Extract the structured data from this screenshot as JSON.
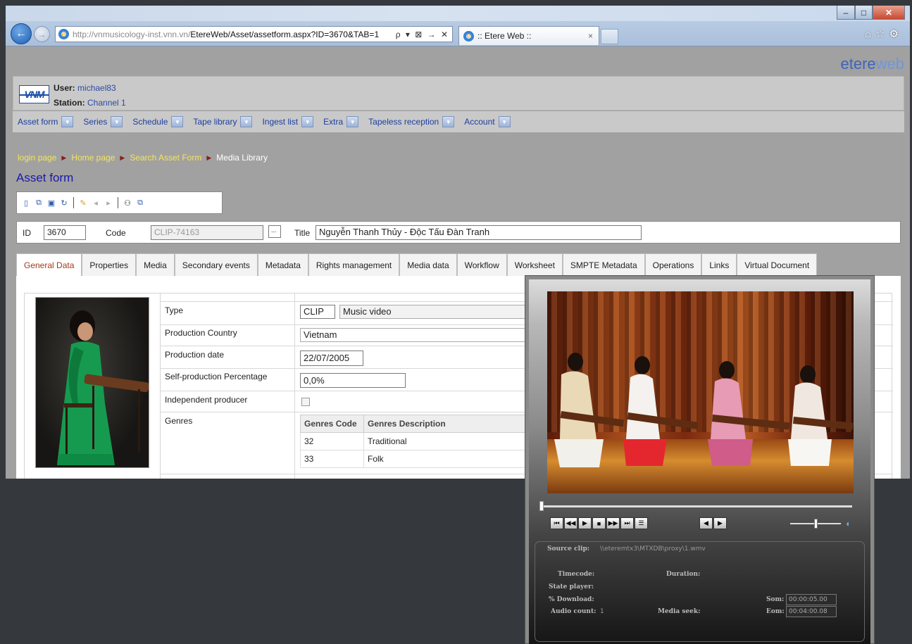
{
  "browser": {
    "url_host": "http://vnmusicology-inst.vnn.vn/",
    "url_path": "EtereWeb/Asset/assetform.aspx?ID=3670&TAB=1",
    "addr_controls": "ρ ▾ ⊠ → ✕",
    "tab_title": ":: Etere Web ::",
    "tab_close": "×",
    "window_min": "–",
    "window_max": "□",
    "window_close": "✕",
    "tools": "⌂☆⚙"
  },
  "brand": {
    "main": "etere",
    "accent": "web"
  },
  "user": {
    "logo": "VNM",
    "user_label": "User:",
    "user_value": "michael83",
    "station_label": "Station:",
    "station_value": "Channel 1"
  },
  "menu": [
    "Asset form",
    "Series",
    "Schedule",
    "Tape library",
    "Ingest list",
    "Extra",
    "Tapeless reception",
    "Account"
  ],
  "breadcrumb": [
    "login page",
    "Home page",
    "Search Asset Form",
    "Media Library"
  ],
  "form_title": "Asset form",
  "idbar": {
    "id_label": "ID",
    "id_value": "3670",
    "code_label": "Code",
    "code_value": "CLIP-74163",
    "browse": "...",
    "title_label": "Title",
    "title_value": "Nguyễn Thanh Thủy - Độc Tấu Đàn Tranh"
  },
  "tabs": [
    "General Data",
    "Properties",
    "Media",
    "Secondary events",
    "Metadata",
    "Rights management",
    "Media data",
    "Workflow",
    "Worksheet",
    "SMPTE Metadata",
    "Operations",
    "Links",
    "Virtual Document"
  ],
  "general": {
    "type_label": "Type",
    "type_code": "CLIP",
    "type_desc": "Music video",
    "country_label": "Production Country",
    "country_value": "Vietnam",
    "date_label": "Production date",
    "date_value": "22/07/2005",
    "selfprod_label": "Self-production Percentage",
    "selfprod_value": "0,0%",
    "indep_label": "Independent producer",
    "genres_label": "Genres",
    "genres_headers": [
      "Genres Code",
      "Genres Description"
    ],
    "genres_rows": [
      [
        "32",
        "Traditional"
      ],
      [
        "33",
        "Folk"
      ]
    ]
  },
  "player": {
    "source_label": "Source clip:",
    "source_value": "\\\\eteremtx3\\MTXDB\\proxy\\1.wmv",
    "timecode_label": "Timecode:",
    "duration_label": "Duration:",
    "state_label": "State player:",
    "download_label": "% Download:",
    "audio_label": "Audio count:",
    "audio_value": "1",
    "seek_label": "Media seek:",
    "som_label": "Som:",
    "som_value": "00:00:05.00",
    "eom_label": "Eom:",
    "eom_value": "00:04:00.08",
    "seek_position": 0.0,
    "volume_level": 0.5
  }
}
